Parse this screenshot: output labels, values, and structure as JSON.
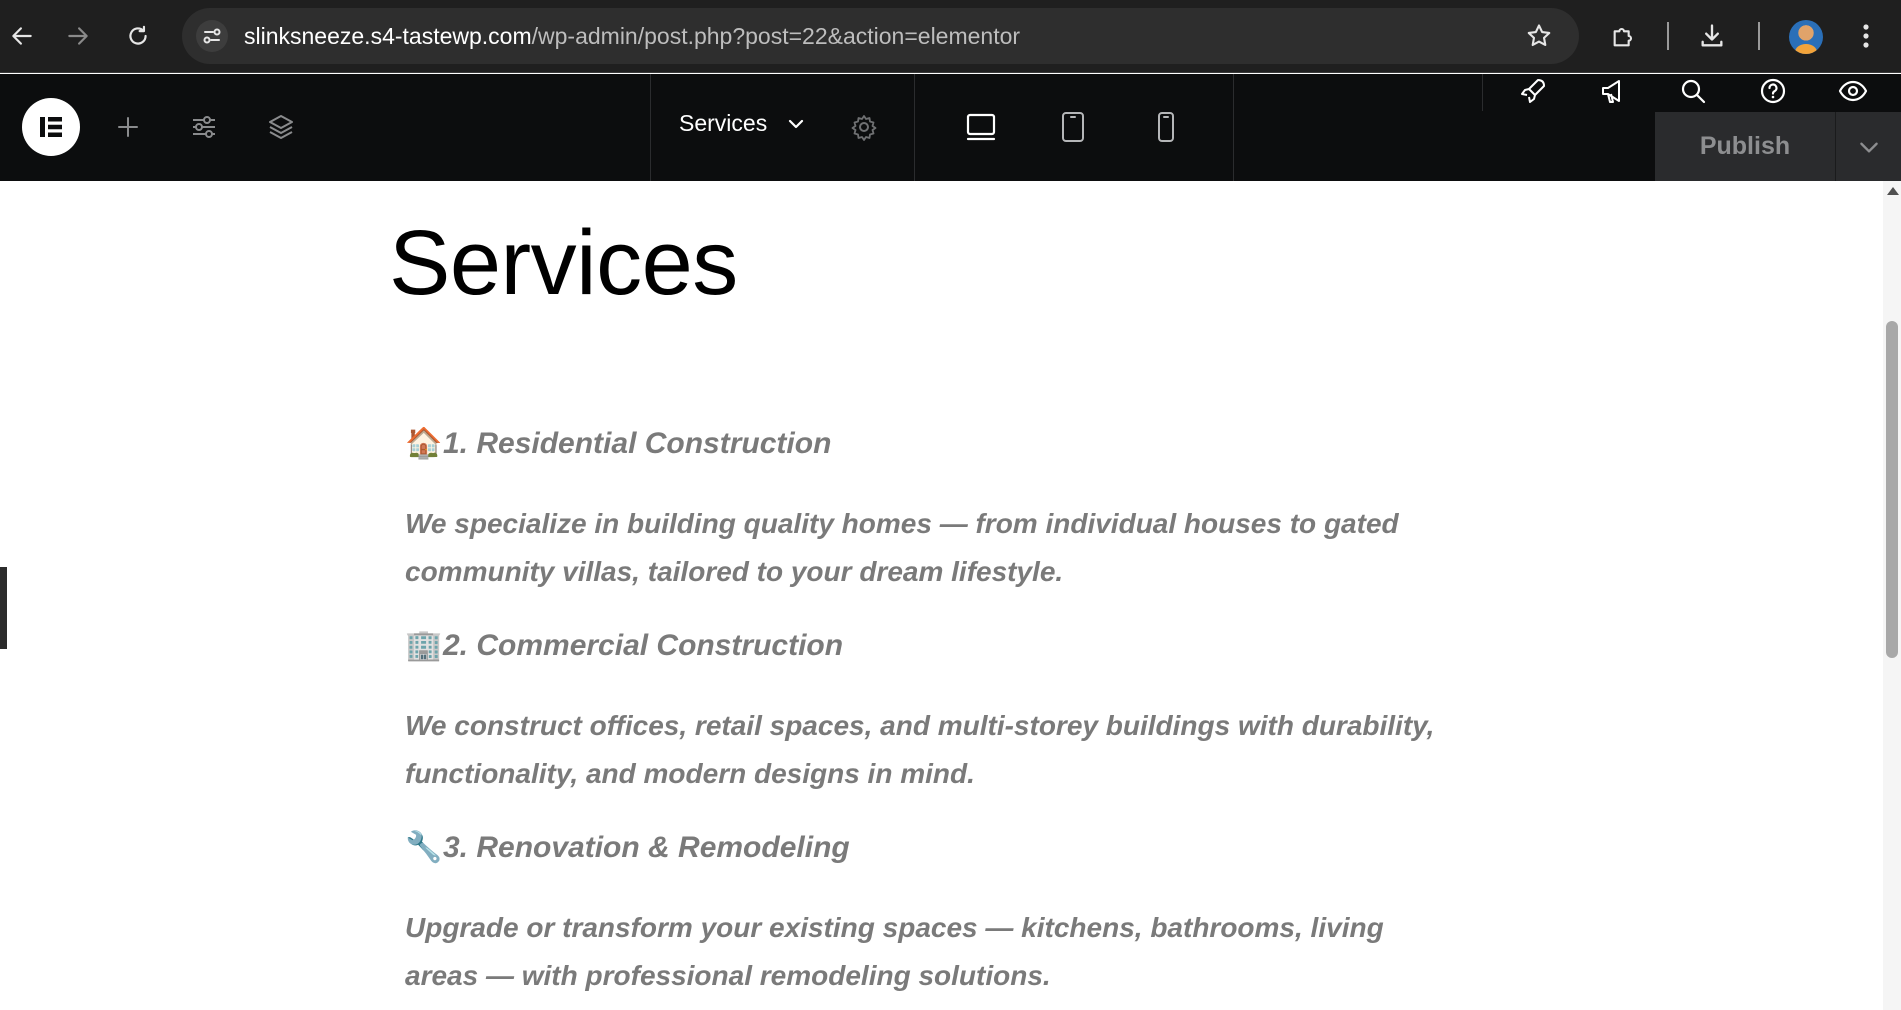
{
  "browser": {
    "url_host": "slinksneeze.s4-tastewp.com",
    "url_path": "/wp-admin/post.php?post=22&action=elementor",
    "icons": {
      "back": "back-arrow-icon",
      "forward": "forward-arrow-icon",
      "reload": "reload-icon",
      "site_info": "site-info-icon",
      "bookmark": "star-icon",
      "extensions": "puzzle-icon",
      "downloads": "download-icon",
      "menu": "kebab-menu-icon"
    }
  },
  "editor": {
    "page_name": "Services",
    "publish_label": "Publish",
    "icons": {
      "logo": "elementor-logo-icon",
      "add": "plus-icon",
      "site_settings": "sliders-icon",
      "structure": "layers-icon",
      "page_settings": "gear-icon",
      "desktop": "desktop-icon",
      "tablet": "tablet-icon",
      "mobile": "mobile-icon",
      "launchpad": "rocket-icon",
      "whats_new": "megaphone-icon",
      "finder": "search-icon",
      "help": "help-icon",
      "preview": "eye-icon"
    },
    "colors": {
      "bar_bg": "#0c0d0e",
      "publish_bg": "#2a2b2d",
      "publish_text": "#8d8e90"
    }
  },
  "page": {
    "heading": "Services",
    "services": [
      {
        "emoji": "🏠",
        "title": "1. Residential Construction",
        "description": "We specialize in building quality homes — from individual houses to gated community villas, tailored to your dream lifestyle."
      },
      {
        "emoji": "🏢",
        "title": "2. Commercial Construction",
        "description": "We construct offices, retail spaces, and multi-storey buildings with durability, functionality, and modern designs in mind."
      },
      {
        "emoji": "🔧",
        "title": "3. Renovation & Remodeling",
        "description": "Upgrade or transform your existing spaces — kitchens, bathrooms, living areas — with professional remodeling solutions."
      }
    ],
    "colors": {
      "heading": "#000000",
      "body_text": "#7a7a7a"
    }
  }
}
